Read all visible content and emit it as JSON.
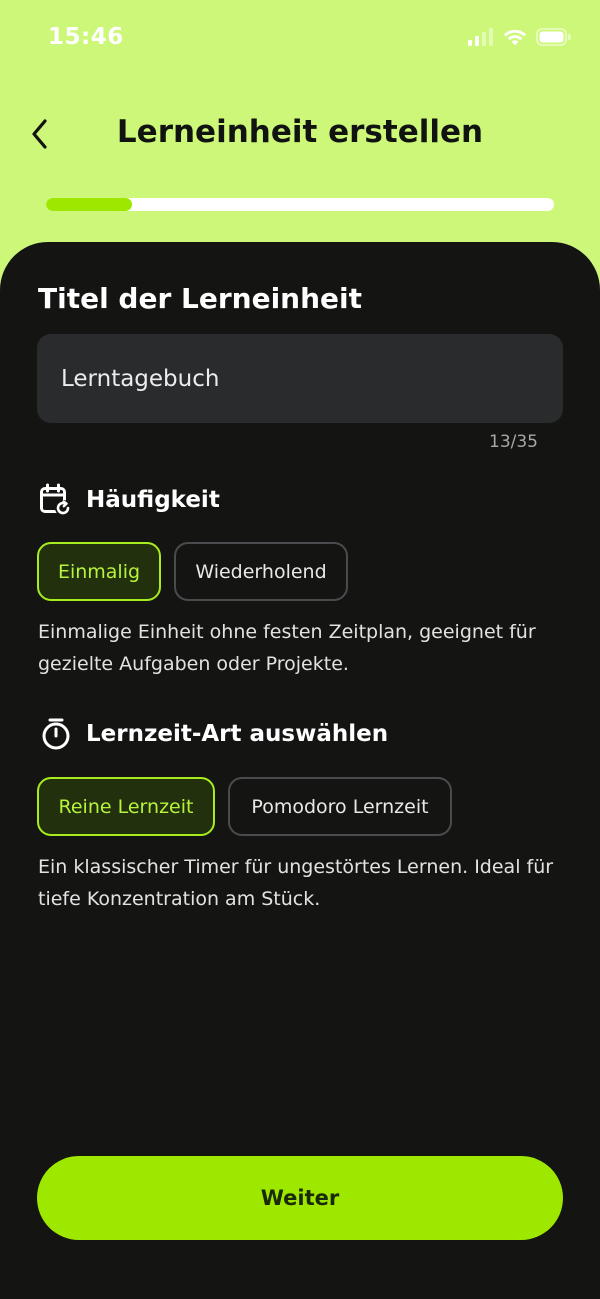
{
  "status_bar": {
    "time": "15:46"
  },
  "header": {
    "title": "Lerneinheit erstellen",
    "back_icon": "chevron-left-icon"
  },
  "progress": {
    "value": 0.17
  },
  "title_section": {
    "heading": "Titel der Lerneinheit",
    "input_value": "Lerntagebuch",
    "counter": "13/35"
  },
  "frequency": {
    "icon": "calendar-repeat-icon",
    "heading": "Häufigkeit",
    "options": [
      "Einmalig",
      "Wiederholend"
    ],
    "selected": "Einmalig",
    "description": "Einmalige Einheit ohne festen Zeitplan, geeignet für gezielte Aufgaben oder Projekte."
  },
  "study_time": {
    "icon": "stopwatch-icon",
    "heading": "Lernzeit-Art auswählen",
    "options": [
      "Reine Lernzeit",
      "Pomodoro Lernzeit"
    ],
    "selected": "Reine Lernzeit",
    "description": "Ein klassischer Timer für ungestörtes Lernen. Ideal für tiefe Konzentration am Stück."
  },
  "footer": {
    "next_label": "Weiter"
  },
  "colors": {
    "background": "#cdf778",
    "sheet": "#141513",
    "accent": "#9ee800"
  }
}
